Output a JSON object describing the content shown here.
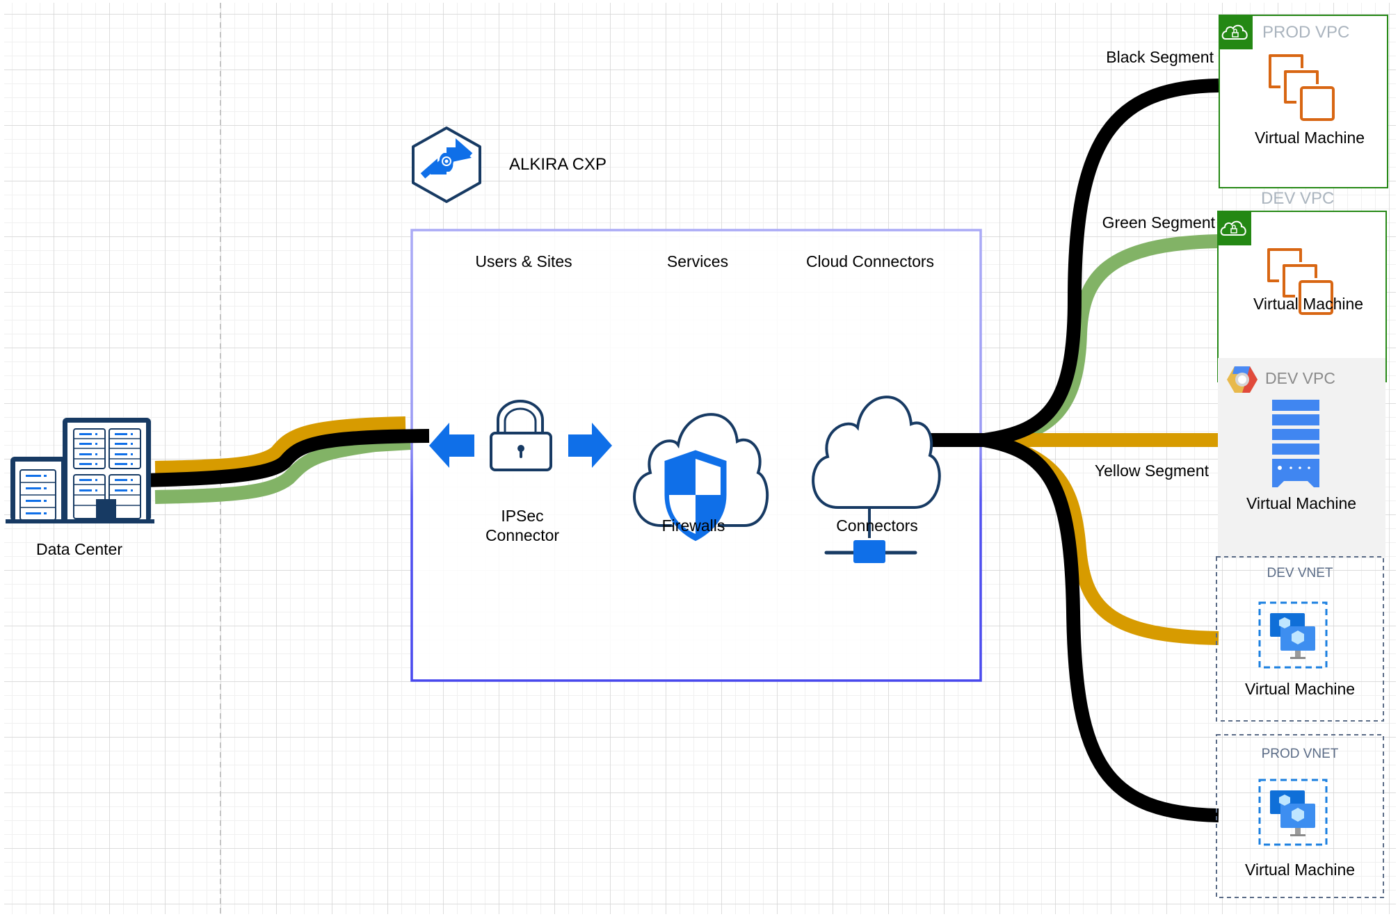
{
  "diagram": {
    "title": "ALKIRA CXP",
    "logo_icon": "alkira-exchange-hexagon-icon",
    "cxp_columns": [
      {
        "header": "Users & Sites",
        "icon": "padlock-with-bidirectional-arrows-icon",
        "label_line1": "IPSec",
        "label_line2": "Connector"
      },
      {
        "header": "Services",
        "icon": "cloud-shield-icon",
        "label": "Firewalls"
      },
      {
        "header": "Cloud Connectors",
        "icon": "cloud-network-icon",
        "label": "Connectors"
      }
    ],
    "data_center": {
      "label": "Data Center",
      "icon": "office-building-servers-icon"
    },
    "segments": {
      "black": {
        "label": "Black Segment",
        "color": "#000000"
      },
      "green": {
        "label": "Green Segment",
        "color": "#82b366"
      },
      "yellow": {
        "label": "Yellow Segment",
        "color": "#d79b00"
      }
    },
    "clouds": [
      {
        "title": "PROD VPC",
        "provider_icon": "aws-vpc-cloud-lock-icon",
        "vm_icon": "aws-ec2-instances-icon",
        "vm_label": "Virtual Machine",
        "segment": "black"
      },
      {
        "title": "DEV VPC",
        "provider_icon": "aws-vpc-cloud-lock-icon",
        "vm_icon": "aws-ec2-instances-icon",
        "vm_label": "Virtual Machine",
        "segment": "green"
      },
      {
        "title": "DEV VPC",
        "provider_icon": "gcp-logo-icon",
        "vm_icon": "gcp-compute-server-icon",
        "vm_label": "Virtual Machine",
        "segment": "yellow"
      },
      {
        "title": "DEV VNET",
        "provider_icon": "",
        "vm_icon": "azure-vm-icon",
        "vm_label": "Virtual Machine",
        "segment": "yellow"
      },
      {
        "title": "PROD VNET",
        "provider_icon": "",
        "vm_icon": "azure-vm-icon",
        "vm_label": "Virtual Machine",
        "segment": "black"
      }
    ],
    "colors": {
      "aws_green": "#248814",
      "aws_title_gray": "#aab4be",
      "ec2_orange": "#d86613",
      "gcp_bg": "#f2f2f2",
      "gcp_blue": "#4086f1",
      "azure_title": "#5a6b86",
      "azure_dash": "#1a7fe0",
      "icon_navy": "#173a63",
      "icon_blue": "#0f6fe8",
      "frame_blue": "#4a4af0"
    }
  }
}
